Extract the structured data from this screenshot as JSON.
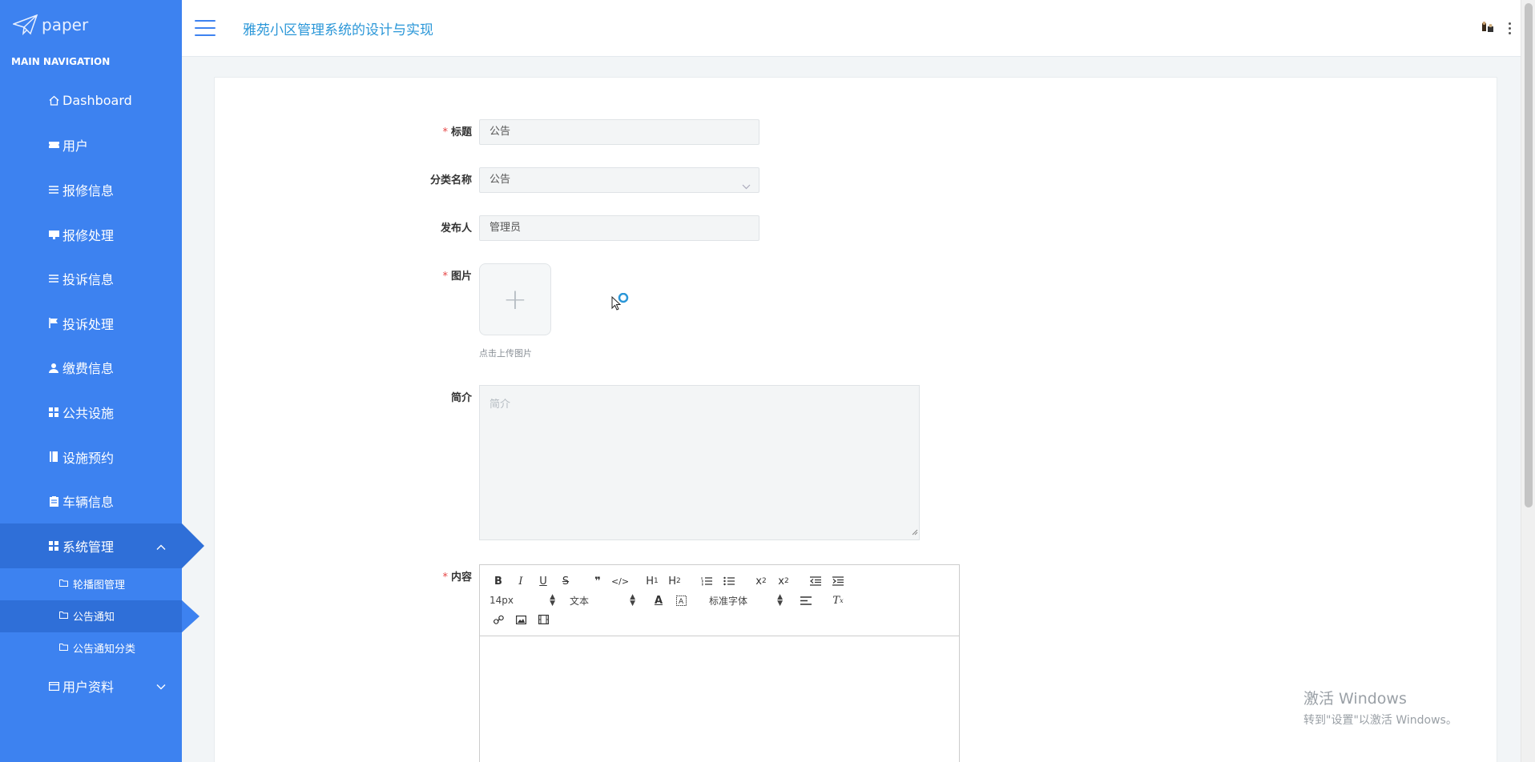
{
  "brand": {
    "name": "paper"
  },
  "sidebar": {
    "header": "MAIN NAVIGATION",
    "items": [
      {
        "label": "Dashboard",
        "icon": "home-icon"
      },
      {
        "label": "用户",
        "icon": "ticket-icon"
      },
      {
        "label": "报修信息",
        "icon": "list-icon"
      },
      {
        "label": "报修处理",
        "icon": "monitor-icon"
      },
      {
        "label": "投诉信息",
        "icon": "list-icon"
      },
      {
        "label": "投诉处理",
        "icon": "flag-icon"
      },
      {
        "label": "缴费信息",
        "icon": "user-icon"
      },
      {
        "label": "公共设施",
        "icon": "grid-icon"
      },
      {
        "label": "设施预约",
        "icon": "book-icon"
      },
      {
        "label": "车辆信息",
        "icon": "clipboard-icon"
      },
      {
        "label": "系统管理",
        "icon": "grid-icon"
      }
    ],
    "sub_items": [
      {
        "label": "轮播图管理",
        "icon": "folder-icon"
      },
      {
        "label": "公告通知",
        "icon": "folder-icon"
      },
      {
        "label": "公告通知分类",
        "icon": "folder-icon"
      }
    ],
    "last_item": {
      "label": "用户资料",
      "icon": "card-icon"
    }
  },
  "topbar": {
    "title": "雅苑小区管理系统的设计与实现"
  },
  "form": {
    "title_label": "标题",
    "title_value": "公告",
    "category_label": "分类名称",
    "category_value": "公告",
    "publisher_label": "发布人",
    "publisher_value": "管理员",
    "image_label": "图片",
    "upload_tip": "点击上传图片",
    "intro_label": "简介",
    "intro_placeholder": "简介",
    "content_label": "内容",
    "editor": {
      "font_size": "14px",
      "header_select": "文本",
      "font_family": "标准字体"
    }
  },
  "watermark": {
    "line1": "激活 Windows",
    "line2": "转到\"设置\"以激活 Windows。"
  },
  "colors": {
    "sidebar": "#3d82f0",
    "sidebar_active": "#2f6fd8",
    "title": "#2b97d8",
    "required": "#e64545"
  }
}
